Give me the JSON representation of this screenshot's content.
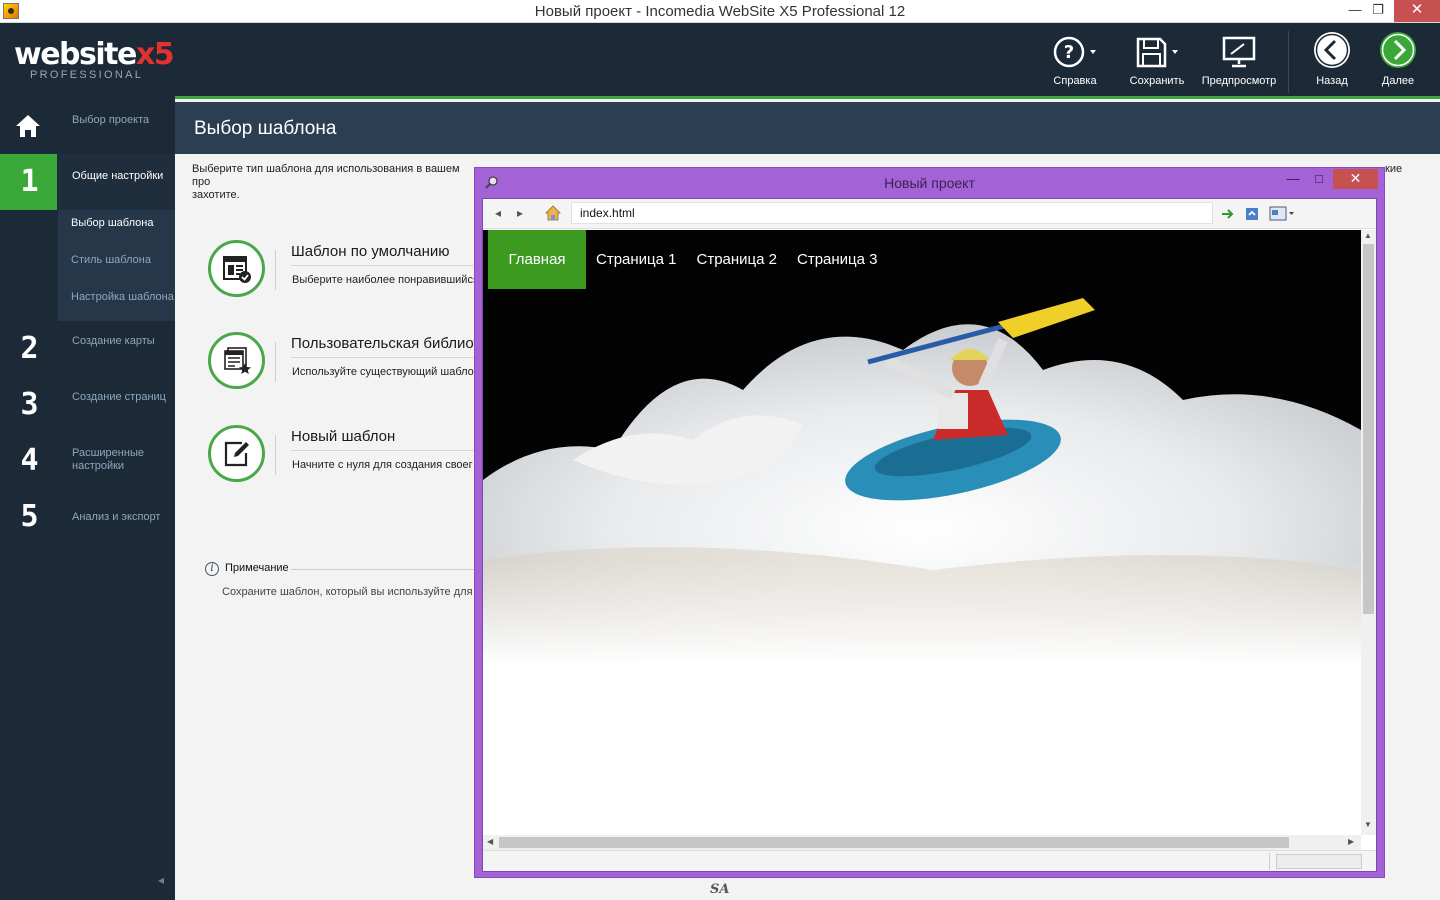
{
  "window": {
    "title": "Новый проект - Incomedia WebSite X5 Professional 12",
    "minimize": "—",
    "restore": "❐",
    "close": "✕"
  },
  "logo": {
    "main": "website",
    "x5": "x5",
    "sub": "PROFESSIONAL"
  },
  "sidebar": {
    "home_label": "Выбор проекта",
    "steps": [
      {
        "num": "1",
        "label": "Общие настройки"
      },
      {
        "num": "2",
        "label": "Создание карты"
      },
      {
        "num": "3",
        "label": "Создание страниц"
      },
      {
        "num": "4",
        "label": "Расширенные настройки"
      },
      {
        "num": "5",
        "label": "Анализ и экспорт"
      }
    ],
    "substeps": [
      "Выбор шаблона",
      "Стиль шаблона",
      "Настройка шаблона"
    ],
    "collapse": "◂"
  },
  "toolbar": {
    "help": "Справка",
    "save": "Сохранить",
    "preview": "Предпросмотр",
    "back": "Назад",
    "next": "Далее"
  },
  "page": {
    "title": "Выбор шаблона",
    "intro": "Выберите тип шаблона для использования в вашем про",
    "intro_line2": "захотите.",
    "intro_tail": "кие"
  },
  "options": [
    {
      "title": "Шаблон по умолчанию",
      "desc": "Выберите наиболее понравившийся"
    },
    {
      "title": "Пользовательская библиот",
      "desc": "Используйте существующий шабло"
    },
    {
      "title": "Новый шаблон",
      "desc": "Начните с нуля для создания своег"
    }
  ],
  "note": {
    "icon": "i",
    "title": "Примечание",
    "text": "Сохраните шаблон, который вы используйте для"
  },
  "footer_mark": "SA",
  "preview": {
    "title": "Новый проект",
    "min": "—",
    "max": "□",
    "close": "✕",
    "url": "index.html",
    "back": "◂",
    "forward": "▸",
    "menu": [
      "Главная",
      "Страница 1",
      "Страница 2",
      "Страница 3"
    ]
  },
  "colors": {
    "accent_green": "#3aa838",
    "sidebar_bg": "#1c2a37",
    "preview_frame": "#a362d6"
  }
}
